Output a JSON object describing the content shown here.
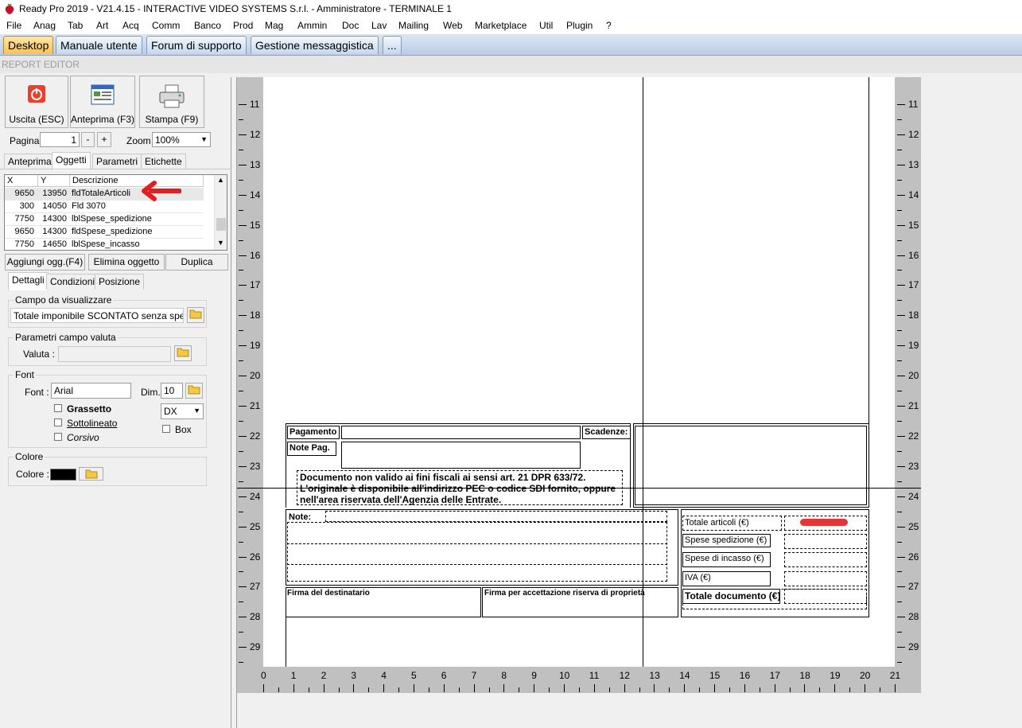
{
  "window": {
    "title": "Ready Pro 2019 - V21.4.15 - INTERACTIVE VIDEO SYSTEMS S.r.l. - Amministratore - TERMINALE 1"
  },
  "menu": [
    "File",
    "Anag",
    "Tab",
    "Art",
    "Acq",
    "Comm",
    "Banco",
    "Prod",
    "Mag",
    "Ammin",
    "Doc",
    "Lav",
    "Mailing",
    "Web",
    "Marketplace",
    "Util",
    "Plugin",
    "?"
  ],
  "tabs": [
    "Desktop",
    "Manuale utente",
    "Forum di supporto",
    "Gestione messaggistica",
    "..."
  ],
  "section_title": "REPORT EDITOR",
  "toolbar": {
    "exit": "Uscita (ESC)",
    "preview": "Anteprima (F3)",
    "print": "Stampa (F9)"
  },
  "paging": {
    "page_label": "Pagina",
    "page_value": "1",
    "minus": "-",
    "plus": "+",
    "zoom_label": "Zoom",
    "zoom_value": "100%"
  },
  "left_tabs": [
    "Anteprima",
    "Oggetti",
    "Parametri",
    "Etichette"
  ],
  "grid": {
    "headers": [
      "X",
      "Y",
      "Descrizione"
    ],
    "rows": [
      [
        "9650",
        "13950",
        "fldTotaleArticoli"
      ],
      [
        "300",
        "14050",
        "Fld 3070"
      ],
      [
        "7750",
        "14300",
        "lblSpese_spedizione"
      ],
      [
        "9650",
        "14300",
        "fldSpese_spedizione"
      ],
      [
        "7750",
        "14650",
        "lblSpese_incasso"
      ]
    ]
  },
  "grid_buttons": {
    "add": "Aggiungi ogg.(F4)",
    "delete": "Elimina oggetto",
    "duplicate": "Duplica"
  },
  "detail_tabs": [
    "Dettagli",
    "Condizioni",
    "Posizione"
  ],
  "campo": {
    "caption": "Campo da visualizzare",
    "value": "Totale imponibile SCONTATO senza spese"
  },
  "valuta": {
    "caption": "Parametri campo valuta",
    "label": "Valuta :",
    "value": ""
  },
  "font": {
    "caption": "Font",
    "label": "Font :",
    "value": "Arial",
    "dim_label": "Dim.",
    "dim_value": "10",
    "bold": "Grassetto",
    "underline": "Sottolineato",
    "italic": "Corsivo",
    "align": "DX",
    "box": "Box"
  },
  "colore": {
    "caption": "Colore",
    "label": "Colore :",
    "value": "#000000"
  },
  "ruler": {
    "vertical": [
      "11",
      "12",
      "13",
      "14",
      "15",
      "16",
      "17",
      "18",
      "19",
      "20",
      "21",
      "22",
      "23",
      "24",
      "25",
      "26",
      "27",
      "28",
      "29"
    ],
    "horizontal": [
      "0",
      "1",
      "2",
      "3",
      "4",
      "5",
      "6",
      "7",
      "8",
      "9",
      "10",
      "11",
      "12",
      "13",
      "14",
      "15",
      "16",
      "17",
      "18",
      "19",
      "20",
      "21"
    ]
  },
  "report": {
    "pagamento": "Pagamento",
    "scadenze": "Scadenze:",
    "note_pag": "Note Pag.",
    "disclaimer1": "Documento non valido ai fini fiscali ai sensi  art. 21  DPR 633/72.",
    "disclaimer2": "L'originale è disponibile all'indirizzo PEC o codice SDI fornito, oppure",
    "disclaimer3": "nell'area riservata dell'Agenzia delle Entrate.",
    "note": "Note:",
    "firma_dest": "Firma del destinatario",
    "firma_acc": "Firma per accettazione riserva di proprietà",
    "totale_articoli": "Totale articoli (€)",
    "spese_spedizione": "Spese spedizione (€)",
    "spese_incasso": "Spese di incasso (€)",
    "iva": "IVA (€)",
    "totale_documento": "Totale documento (€)"
  },
  "annotation_color": "#e02020"
}
